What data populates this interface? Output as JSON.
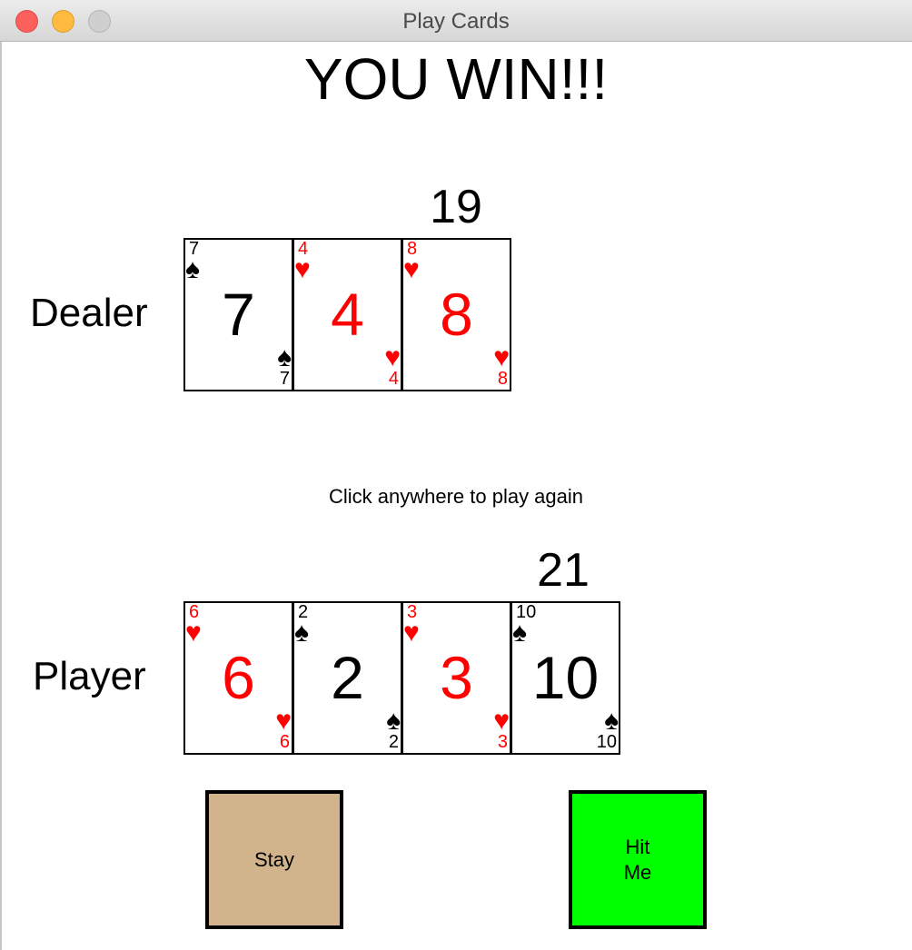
{
  "window": {
    "title": "Play Cards"
  },
  "game": {
    "status": "YOU WIN!!!",
    "prompt": "Click anywhere to play again"
  },
  "dealer": {
    "label": "Dealer",
    "score": "19",
    "cards": [
      {
        "rank": "7",
        "suit": "spades",
        "symbol": "♠",
        "color": "black"
      },
      {
        "rank": "4",
        "suit": "hearts",
        "symbol": "♥",
        "color": "red"
      },
      {
        "rank": "8",
        "suit": "hearts",
        "symbol": "♥",
        "color": "red"
      }
    ]
  },
  "player": {
    "label": "Player",
    "score": "21",
    "cards": [
      {
        "rank": "6",
        "suit": "hearts",
        "symbol": "♥",
        "color": "red"
      },
      {
        "rank": "2",
        "suit": "spades",
        "symbol": "♠",
        "color": "black"
      },
      {
        "rank": "3",
        "suit": "hearts",
        "symbol": "♥",
        "color": "red"
      },
      {
        "rank": "10",
        "suit": "spades",
        "symbol": "♠",
        "color": "black"
      }
    ]
  },
  "buttons": {
    "stay": {
      "label": "Stay",
      "color": "#d2b48c"
    },
    "hit": {
      "label": "Hit\nMe",
      "color": "#00ff00"
    }
  },
  "colors": {
    "red_suit": "#ff0000",
    "black_suit": "#000000"
  }
}
